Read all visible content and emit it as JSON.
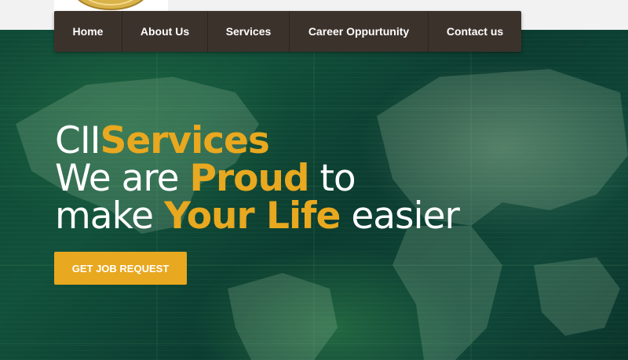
{
  "logo": {
    "icon": "company-seal-logo"
  },
  "nav": {
    "items": [
      {
        "label": "Home"
      },
      {
        "label": "About Us"
      },
      {
        "label": "Services"
      },
      {
        "label": "Career Oppurtunity"
      },
      {
        "label": "Contact us"
      }
    ]
  },
  "hero": {
    "line1": {
      "a": "CII",
      "b": "Services"
    },
    "line2": {
      "a": "We are ",
      "b": "Proud",
      "c": " to"
    },
    "line3": {
      "a": "make ",
      "b": "Your Life",
      "c": " easier"
    },
    "cta_label": "GET JOB REQUEST",
    "background": "world-map-digital-background"
  },
  "colors": {
    "accent": "#e8a81f",
    "nav_bg": "#3c322c",
    "text": "#ffffff",
    "hero_bg": "#0e3a31"
  }
}
